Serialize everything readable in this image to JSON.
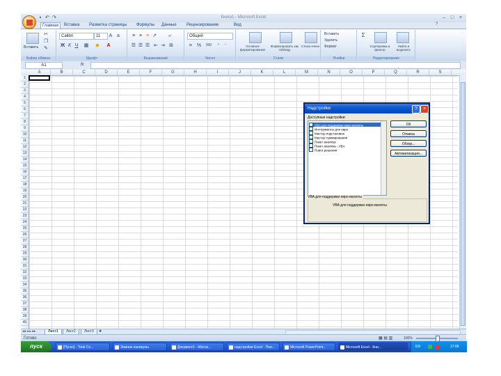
{
  "title_bar": {
    "title": "Книга1 - Microsoft Excel",
    "quick_access": [
      "save-icon",
      "undo-icon",
      "redo-icon"
    ],
    "window_controls": [
      "–",
      "□",
      "×"
    ]
  },
  "tabs": [
    {
      "label": "Главная",
      "active": true
    },
    {
      "label": "Вставка"
    },
    {
      "label": "Разметка страницы"
    },
    {
      "label": "Формулы"
    },
    {
      "label": "Данные"
    },
    {
      "label": "Рецензирование"
    },
    {
      "label": "Вид"
    }
  ],
  "ribbon": {
    "clipboard": {
      "paste": "Вставить",
      "label": "Буфер обмена"
    },
    "font": {
      "name": "Calibri",
      "size": "11",
      "label": "Шрифт",
      "bold": "Ж",
      "italic": "К",
      "underline": "Ч"
    },
    "alignment": {
      "label": "Выравнивание"
    },
    "number": {
      "format": "Общий",
      "label": "Число",
      "percent": "%",
      "thousands": "000"
    },
    "styles": {
      "conditional": "Условное форматирование",
      "format_table": "Форматировать как таблицу",
      "cell_styles": "Стили ячеек",
      "label": "Стили"
    },
    "cells": {
      "insert": "Вставить",
      "delete": "Удалить",
      "format": "Формат",
      "label": "Ячейки"
    },
    "editing": {
      "sum": "Σ",
      "sort": "Сортировка и фильтр",
      "find": "Найти и выделить",
      "label": "Редактирование"
    }
  },
  "formula_bar": {
    "name_box": "A1",
    "fx": "fx",
    "value": ""
  },
  "columns": [
    "A",
    "B",
    "C",
    "D",
    "E",
    "F",
    "G",
    "H",
    "I",
    "J",
    "K",
    "L",
    "M",
    "N",
    "O",
    "P",
    "Q",
    "R",
    "S"
  ],
  "rows": [
    "1",
    "2",
    "3",
    "4",
    "5",
    "6",
    "7",
    "8",
    "9",
    "10",
    "11",
    "12",
    "13",
    "14",
    "15",
    "16",
    "17",
    "18",
    "19",
    "20",
    "21",
    "22",
    "23",
    "24",
    "25",
    "26",
    "27",
    "28",
    "29",
    "30",
    "31",
    "32",
    "33",
    "34",
    "35",
    "36",
    "37",
    "38",
    "39",
    "40"
  ],
  "sheet_tabs": [
    {
      "label": "Лист1",
      "active": true
    },
    {
      "label": "Лист2"
    },
    {
      "label": "Лист3"
    }
  ],
  "status": {
    "text": "Готово",
    "zoom": "100%"
  },
  "dialog": {
    "title": "Надстройки",
    "caption": "Доступные надстройки:",
    "items": [
      {
        "label": "VBA для поддержки евро-валюты",
        "checked": false,
        "selected": true
      },
      {
        "label": "Инструменты для евро",
        "checked": false
      },
      {
        "label": "Мастер подстановок",
        "checked": false
      },
      {
        "label": "Мастер суммирования",
        "checked": false
      },
      {
        "label": "Пакет анализа",
        "checked": false
      },
      {
        "label": "Пакет анализа - VBA",
        "checked": false
      },
      {
        "label": "Поиск решения",
        "checked": false
      }
    ],
    "buttons": {
      "ok": "ОК",
      "cancel": "Отмена",
      "browse": "Обзор...",
      "automation": "Автоматизация..."
    },
    "description_label": "VBA для поддержки евро-валюты",
    "description": "VBA для поддержки евро-валюты"
  },
  "taskbar": {
    "start": "пуск",
    "tasks": [
      {
        "label": "[Пуско] - Total Co..."
      },
      {
        "label": "Зимние каникулы"
      },
      {
        "label": "Документ1 - Micros..."
      },
      {
        "label": "надстройки Excel - Пои..."
      },
      {
        "label": "Microsoft PowerPoint..."
      },
      {
        "label": "Microsoft Excel - Кни...",
        "active": true
      }
    ],
    "lang": "EN",
    "clock": "17:06"
  }
}
